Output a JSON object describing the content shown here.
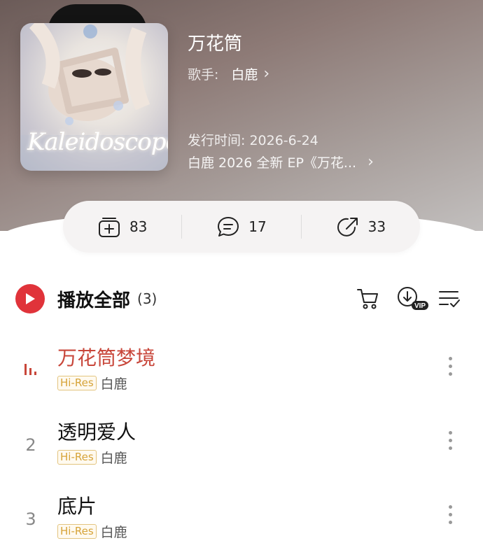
{
  "album": {
    "cover_text": "Kaleidoscope",
    "title": "万花筒",
    "artist_label": "歌手:",
    "artist_name": "白鹿",
    "release": "发行时间: 2026-6-24",
    "description": "白鹿 2026 全新 EP《万花..."
  },
  "actions": {
    "collect_count": "83",
    "comment_count": "17",
    "share_count": "33"
  },
  "playlist": {
    "play_all_label": "播放全部",
    "count": "(3)"
  },
  "songs": [
    {
      "index": "",
      "title": "万花筒梦境",
      "badge": "Hi-Res",
      "artist": "白鹿",
      "playing": true
    },
    {
      "index": "2",
      "title": "透明爱人",
      "badge": "Hi-Res",
      "artist": "白鹿",
      "playing": false
    },
    {
      "index": "3",
      "title": "底片",
      "badge": "Hi-Res",
      "artist": "白鹿",
      "playing": false
    }
  ],
  "colors": {
    "accent": "#e0333a",
    "playing_title": "#c8463a",
    "badge": "#d6a338"
  },
  "icons": {
    "vip_badge": "VIP"
  }
}
